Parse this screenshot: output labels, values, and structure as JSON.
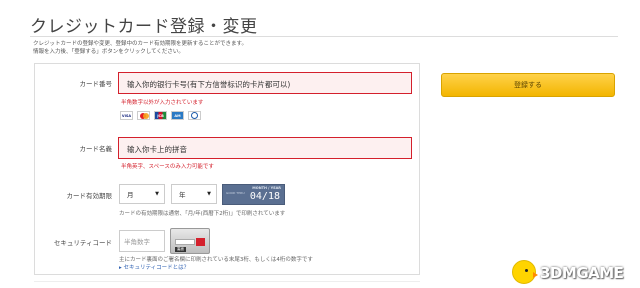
{
  "page": {
    "title": "クレジットカード登録・変更",
    "description_line1": "クレジットカードの登録や変更、登録中のカード有効期限を更新することができます。",
    "description_line2": "情報を入力後、「登録する」ボタンをクリックしてください。"
  },
  "form": {
    "card_number": {
      "label": "カード番号",
      "placeholder": "输入你的银行卡号(有下方信誉标识的卡片都可以)",
      "error": "半角数字以外が入力されています",
      "brands": [
        {
          "name": "VISA"
        },
        {
          "name": "MasterCard"
        },
        {
          "name": "JCB"
        },
        {
          "name": "AMERICAN EXPRESS"
        },
        {
          "name": "Diners Club"
        }
      ]
    },
    "card_name": {
      "label": "カード名義",
      "placeholder": "输入你卡上的拼音",
      "error": "半角英字、スペースのみ入力可能です"
    },
    "expiry": {
      "label": "カード有効期限",
      "month_value": "月",
      "year_value": "年",
      "image_header": "MONTH / YEAR",
      "image_small": "GOOD THRU",
      "image_date": "04/18",
      "hint": "カードの有効期限は通常、「月/年(西暦下2桁)」で印刷されています"
    },
    "security": {
      "label": "セキュリティコード",
      "placeholder": "半角数字",
      "card_back_label": "裏面",
      "hint": "主にカード裏面のご署名欄に印刷されている末尾3桁、もしくは4桁の数字です",
      "link": "▸ セキュリティコードとは？"
    }
  },
  "actions": {
    "submit_label": "登録する"
  },
  "watermark": {
    "text": "3DMGAME"
  },
  "colors": {
    "error_red": "#d4202c",
    "error_bg": "#fdf0f0",
    "submit_yellow": "#f3b500",
    "link_blue": "#2a5db0"
  }
}
